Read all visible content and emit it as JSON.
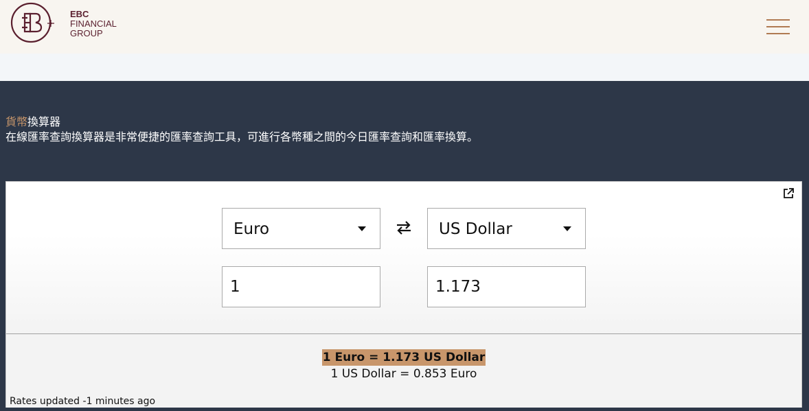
{
  "header": {
    "logo_lines": [
      "EBC",
      "FINANCIAL",
      "GROUP"
    ],
    "brand_color": "#5a1f2e",
    "menu_icon": "hamburger-menu-icon",
    "menu_color": "#b07a52"
  },
  "hero": {
    "title_accent": "貨幣",
    "title_rest": "換算器",
    "description": "在線匯率查詢換算器是非常便捷的匯率查詢工具，可進行各幣種之間的今日匯率查詢和匯率換算。",
    "accent_color": "#c8966b",
    "background": "#2d3748"
  },
  "converter": {
    "from_currency": "Euro",
    "to_currency": "US Dollar",
    "from_amount": "1",
    "to_amount": "1.173",
    "swap_icon": "swap-arrows-icon",
    "external_icon": "external-link-icon",
    "rate_main": "1 Euro = 1.173 US Dollar",
    "rate_inverse": "1 US Dollar = 0.853 Euro",
    "updated": "Rates updated -1 minutes ago",
    "highlight_color": "#c8966b"
  }
}
